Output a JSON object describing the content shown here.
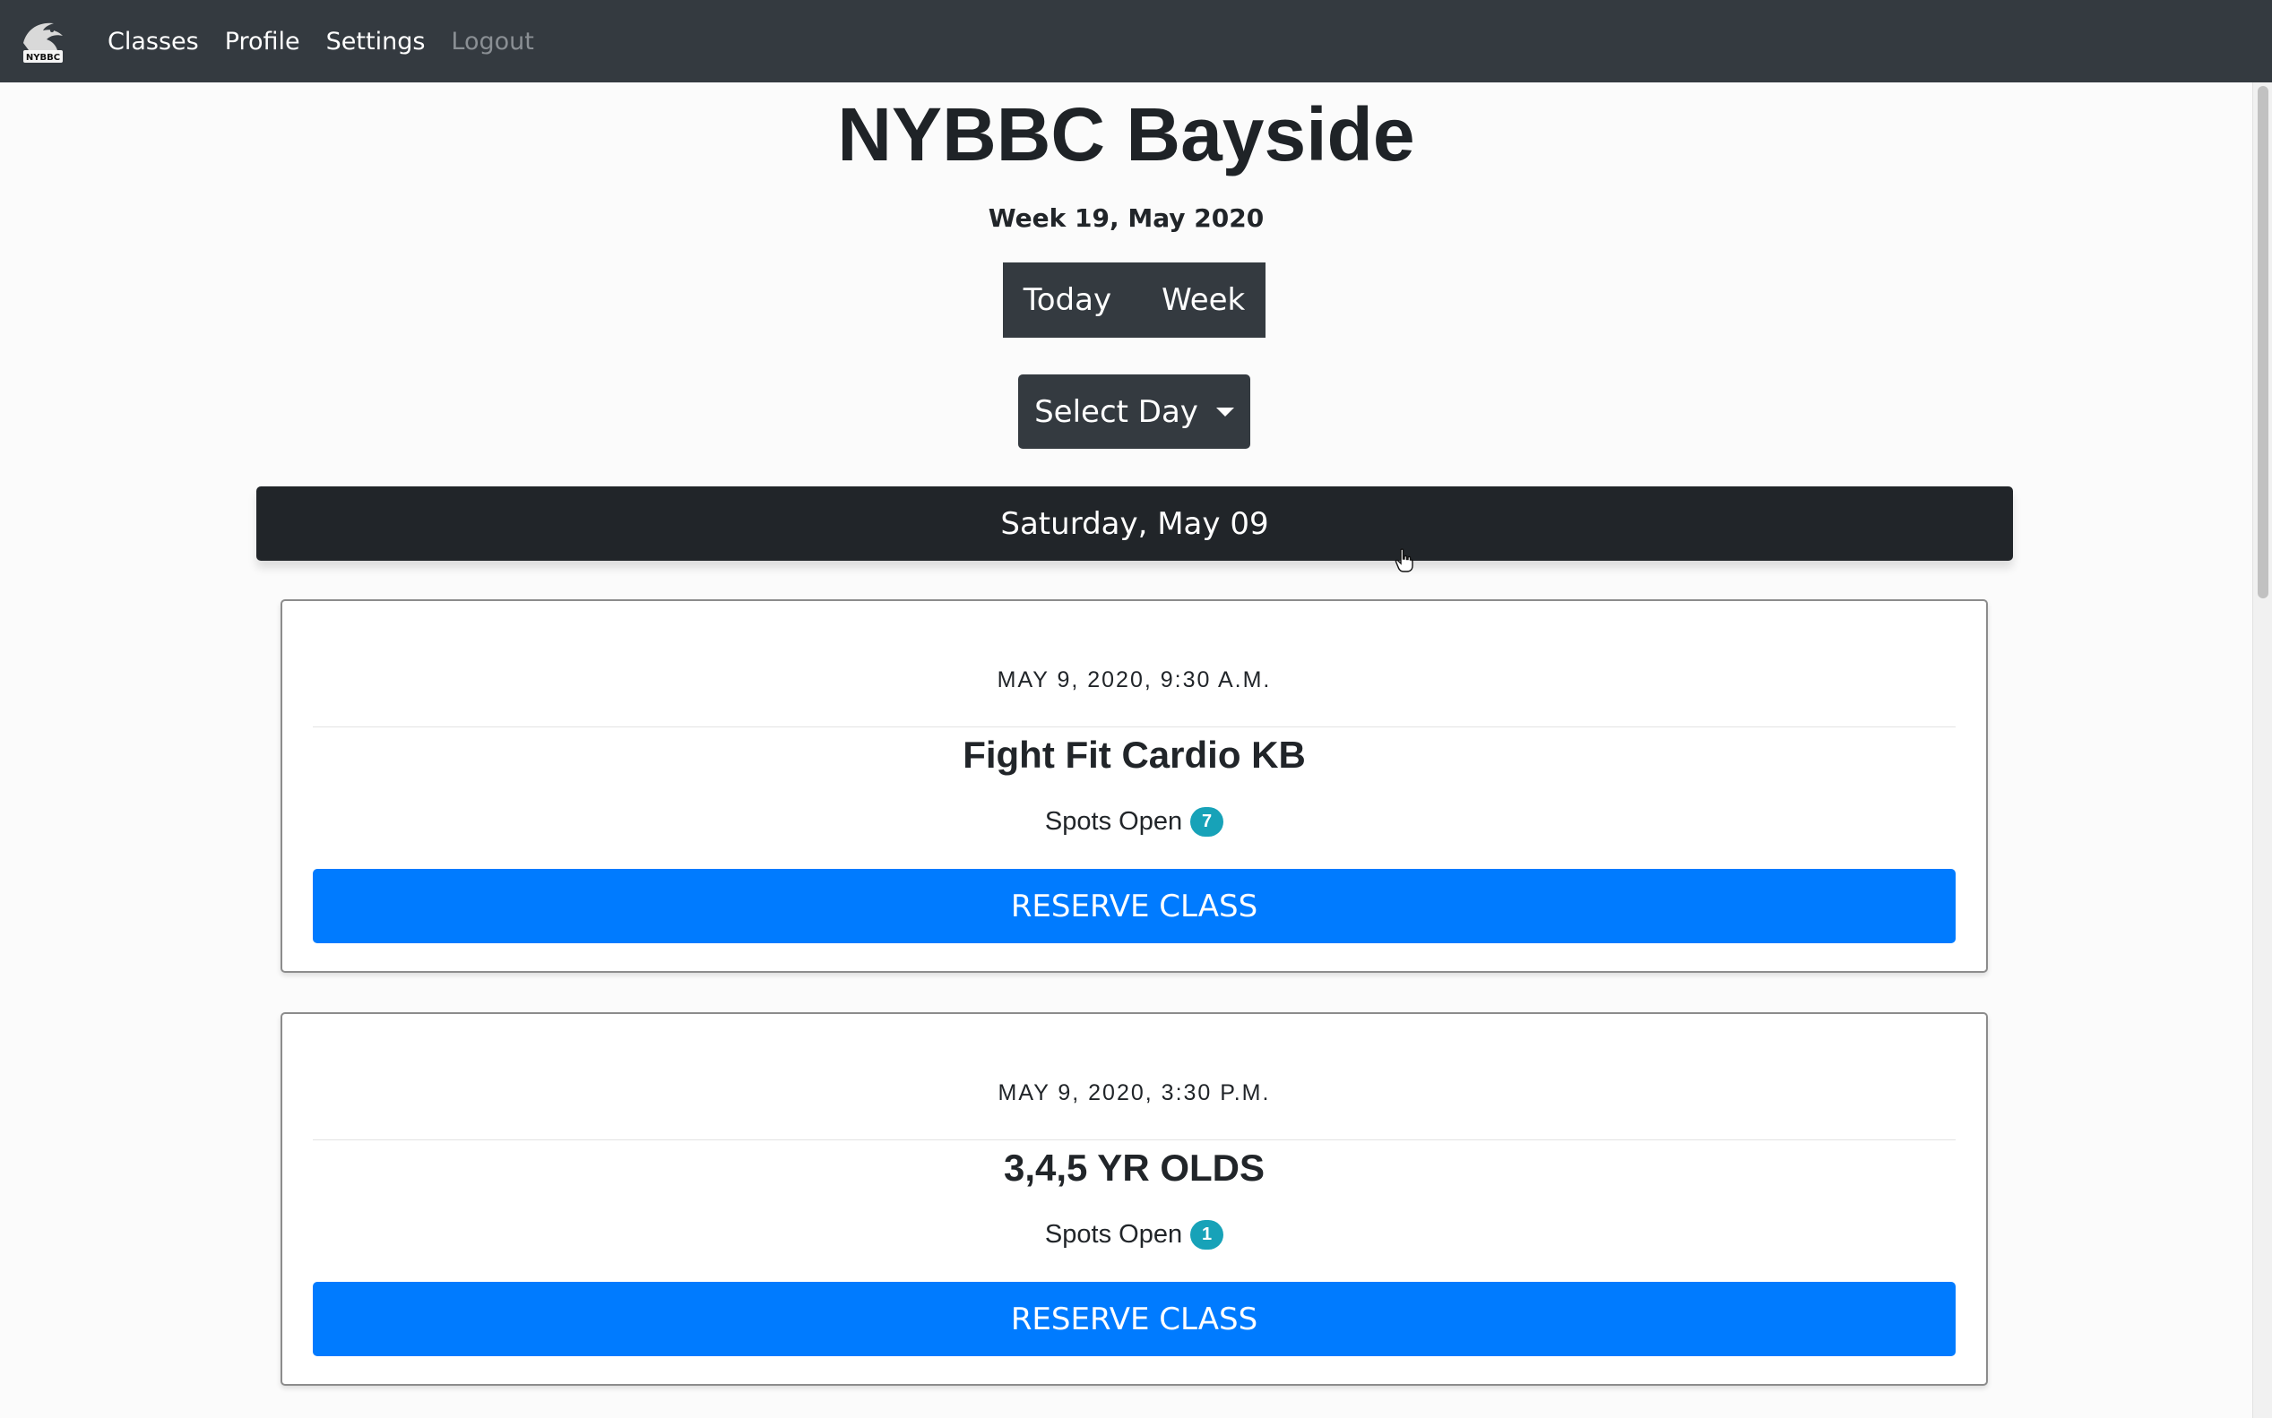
{
  "nav": {
    "logo_text": "NYBBC",
    "links": [
      "Classes",
      "Profile",
      "Settings",
      "Logout"
    ]
  },
  "page": {
    "title": "NYBBC Bayside",
    "week_label": "Week 19, May 2020"
  },
  "view_toggle": {
    "today_label": "Today",
    "week_label": "Week"
  },
  "select_day": {
    "label": "Select Day"
  },
  "day_header": {
    "label": "Saturday, May 09"
  },
  "classes": [
    {
      "datetime": "MAY 9, 2020, 9:30 A.M.",
      "name": "Fight Fit Cardio KB",
      "spots_label": "Spots Open",
      "spots_open": "7",
      "reserve_label": "RESERVE CLASS"
    },
    {
      "datetime": "MAY 9, 2020, 3:30 P.M.",
      "name": "3,4,5 YR OLDS",
      "spots_label": "Spots Open",
      "spots_open": "1",
      "reserve_label": "RESERVE CLASS"
    }
  ],
  "colors": {
    "navbar": "#343a40",
    "primary": "#007bff",
    "badge": "#17a2b8",
    "day_bar": "#212529"
  },
  "icons": {
    "logo": "nybbc-logo-icon",
    "dropdown": "caret-down-icon",
    "cursor": "hand-cursor-icon"
  }
}
